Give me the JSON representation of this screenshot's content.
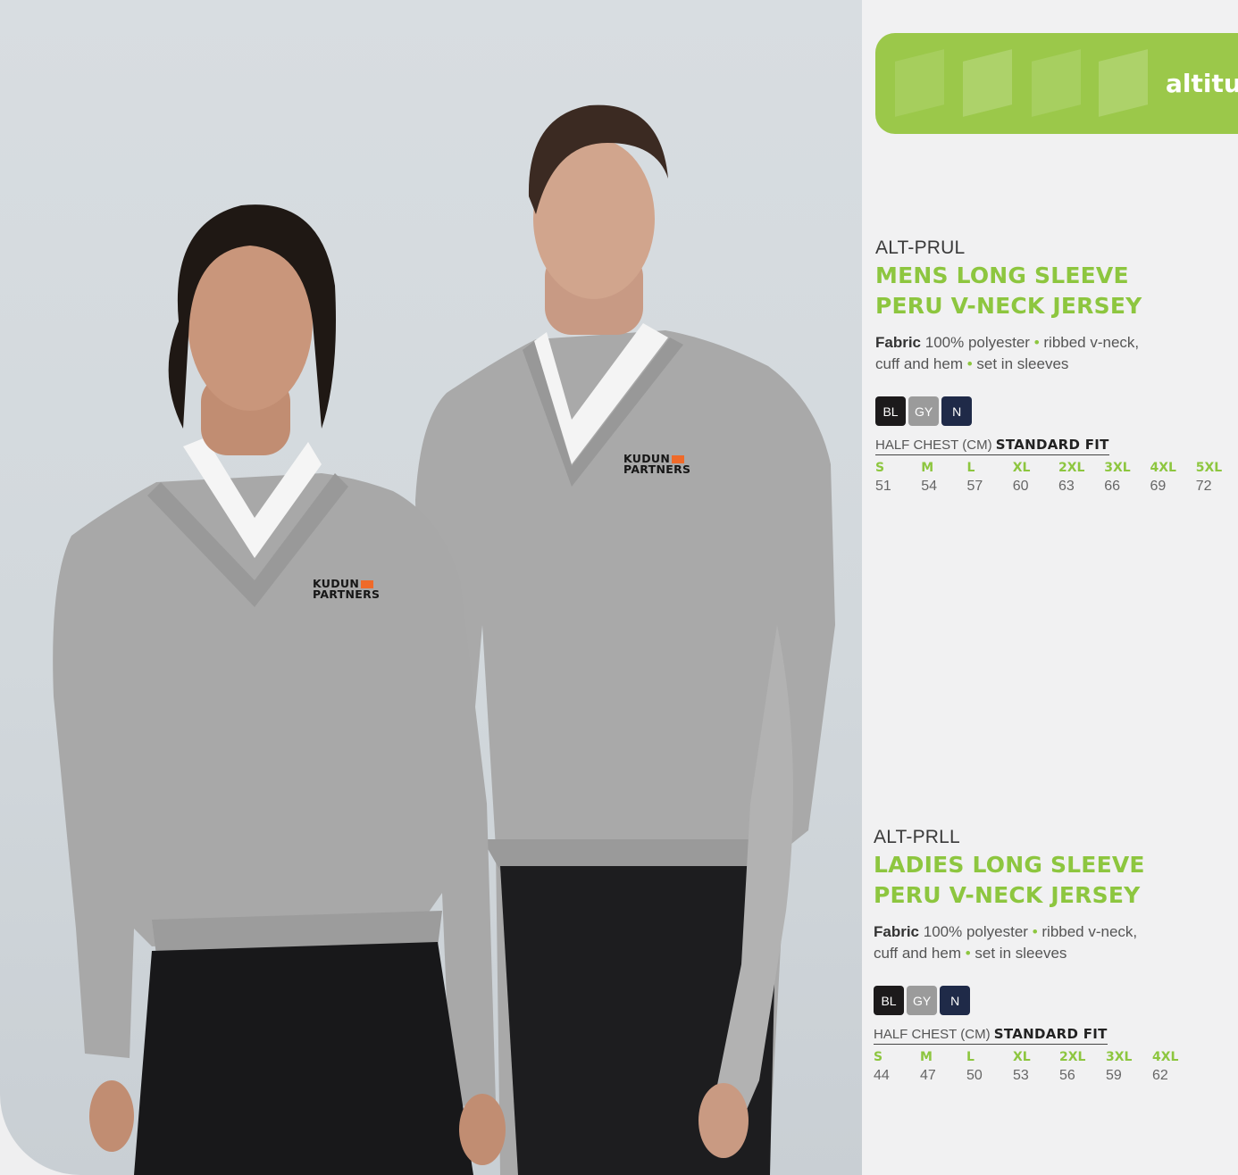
{
  "banner": {
    "brand": "altitu"
  },
  "products": [
    {
      "code": "ALT-PRUL",
      "title_line1": "MENS LONG SLEEVE",
      "title_line2": "PERU V-NECK JERSEY",
      "fabric_label": "Fabric",
      "fabric_text": "100% polyester",
      "feature1": "ribbed v-neck,",
      "feature2": "cuff and hem",
      "feature3": "set in sleeves",
      "colors": [
        {
          "code": "BL",
          "hex": "#1c1a1b"
        },
        {
          "code": "GY",
          "hex": "#9b9b9b"
        },
        {
          "code": "N",
          "hex": "#1f2a48"
        }
      ],
      "size_head_plain": "HALF CHEST (CM)",
      "size_head_bold": "STANDARD FIT",
      "sizes": [
        "S",
        "M",
        "L",
        "XL",
        "2XL",
        "3XL",
        "4XL",
        "5XL"
      ],
      "values": [
        "51",
        "54",
        "57",
        "60",
        "63",
        "66",
        "69",
        "72"
      ]
    },
    {
      "code": "ALT-PRLL",
      "title_line1": "LADIES LONG SLEEVE",
      "title_line2": "PERU V-NECK JERSEY",
      "fabric_label": "Fabric",
      "fabric_text": "100% polyester",
      "feature1": "ribbed v-neck,",
      "feature2": "cuff and hem",
      "feature3": "set in sleeves",
      "colors": [
        {
          "code": "BL",
          "hex": "#1c1a1b"
        },
        {
          "code": "GY",
          "hex": "#9b9b9b"
        },
        {
          "code": "N",
          "hex": "#1f2a48"
        }
      ],
      "size_head_plain": "HALF CHEST (CM)",
      "size_head_bold": "STANDARD FIT",
      "sizes": [
        "S",
        "M",
        "L",
        "XL",
        "2XL",
        "3XL",
        "4XL"
      ],
      "values": [
        "44",
        "47",
        "50",
        "53",
        "56",
        "59",
        "62"
      ]
    }
  ],
  "photo": {
    "logo_line1": "KUDUN",
    "logo_line2": "PARTNERS"
  },
  "colors": {
    "accent": "#8dc63f",
    "banner": "#9bc84a",
    "page": "#f1f1f2"
  }
}
